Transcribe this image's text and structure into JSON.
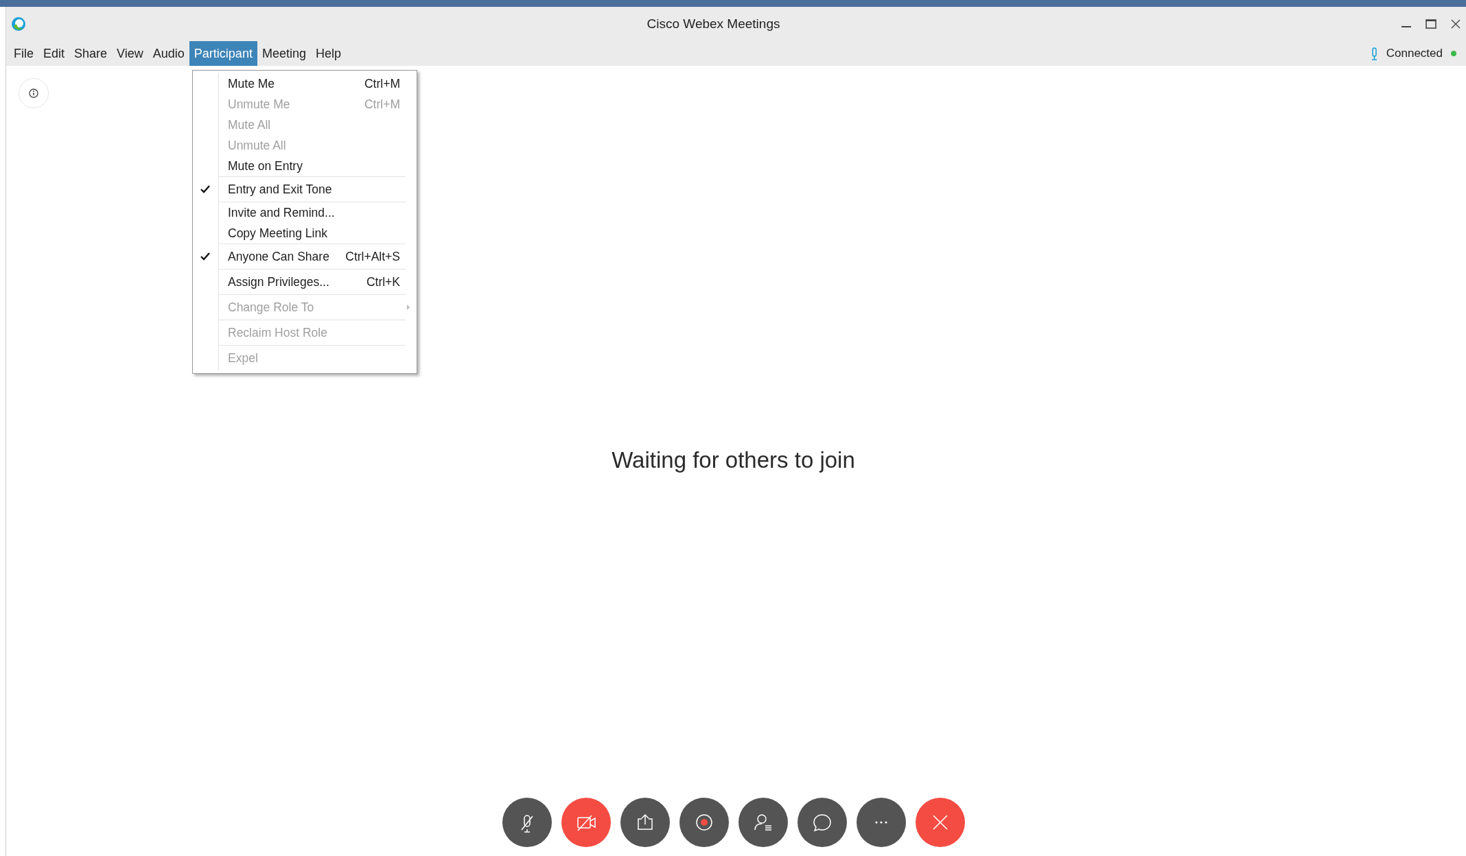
{
  "window": {
    "title": "Cisco Webex Meetings"
  },
  "menu_bar": [
    {
      "label": "File",
      "selected": false
    },
    {
      "label": "Edit",
      "selected": false
    },
    {
      "label": "Share",
      "selected": false
    },
    {
      "label": "View",
      "selected": false
    },
    {
      "label": "Audio",
      "selected": false
    },
    {
      "label": "Participant",
      "selected": true
    },
    {
      "label": "Meeting",
      "selected": false
    },
    {
      "label": "Help",
      "selected": false
    }
  ],
  "status": {
    "label": "Connected",
    "connected": true
  },
  "participant_menu": {
    "groups": [
      [
        {
          "label": "Mute Me",
          "shortcut": "Ctrl+M",
          "checked": false,
          "disabled": false
        },
        {
          "label": "Unmute Me",
          "shortcut": "Ctrl+M",
          "checked": false,
          "disabled": true
        },
        {
          "label": "Mute All",
          "checked": false,
          "disabled": true
        },
        {
          "label": "Unmute All",
          "checked": false,
          "disabled": true
        },
        {
          "label": "Mute on Entry",
          "checked": false,
          "disabled": false
        }
      ],
      [
        {
          "label": "Entry and Exit Tone",
          "checked": true,
          "disabled": false
        }
      ],
      [
        {
          "label": "Invite and Remind...",
          "checked": false,
          "disabled": false
        },
        {
          "label": "Copy Meeting Link",
          "checked": false,
          "disabled": false
        }
      ],
      [
        {
          "label": "Anyone Can Share",
          "shortcut": "Ctrl+Alt+S",
          "checked": true,
          "disabled": false
        }
      ],
      [
        {
          "label": "Assign Privileges...",
          "shortcut": "Ctrl+K",
          "checked": false,
          "disabled": false
        }
      ],
      [
        {
          "label": "Change Role To",
          "submenu": true,
          "checked": false,
          "disabled": true
        }
      ],
      [
        {
          "label": "Reclaim Host Role",
          "checked": false,
          "disabled": true
        }
      ],
      [
        {
          "label": "Expel",
          "checked": false,
          "disabled": true
        }
      ]
    ]
  },
  "stage": {
    "message": "Waiting for others to join"
  },
  "controls": [
    {
      "kind": "mute",
      "color": "#545454"
    },
    {
      "kind": "video",
      "color": "#f44c43"
    },
    {
      "kind": "share",
      "color": "#545454"
    },
    {
      "kind": "record",
      "color": "#545454"
    },
    {
      "kind": "participants",
      "color": "#545454"
    },
    {
      "kind": "chat",
      "color": "#545454"
    },
    {
      "kind": "more",
      "color": "#545454"
    },
    {
      "kind": "leave",
      "color": "#f44c43"
    }
  ]
}
